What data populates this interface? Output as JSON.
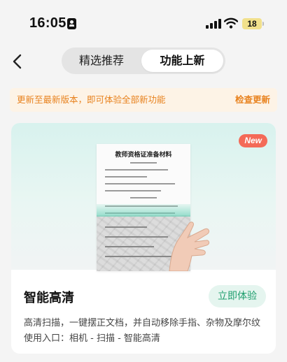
{
  "status_bar": {
    "time": "16:05",
    "battery": "18"
  },
  "nav": {
    "tabs": [
      {
        "label": "精选推荐",
        "active": false
      },
      {
        "label": "功能上新",
        "active": true
      }
    ]
  },
  "notice": {
    "text": "更新至最新版本，即可体验全部新功能",
    "action": "检查更新"
  },
  "feature_card": {
    "badge": "New",
    "doc_title": "教师资格证准备材料",
    "title": "智能高清",
    "button": "立即体验",
    "description": "高清扫描，一键摆正文档，并自动移除手指、杂物及摩尔纹",
    "usage": "使用入口：相机 - 扫描 - 智能高清"
  },
  "colors": {
    "accent_orange": "#e8821e",
    "notice_bg": "#fdf3e6",
    "green": "#1f9e6e",
    "badge_red": "#f46a58"
  }
}
